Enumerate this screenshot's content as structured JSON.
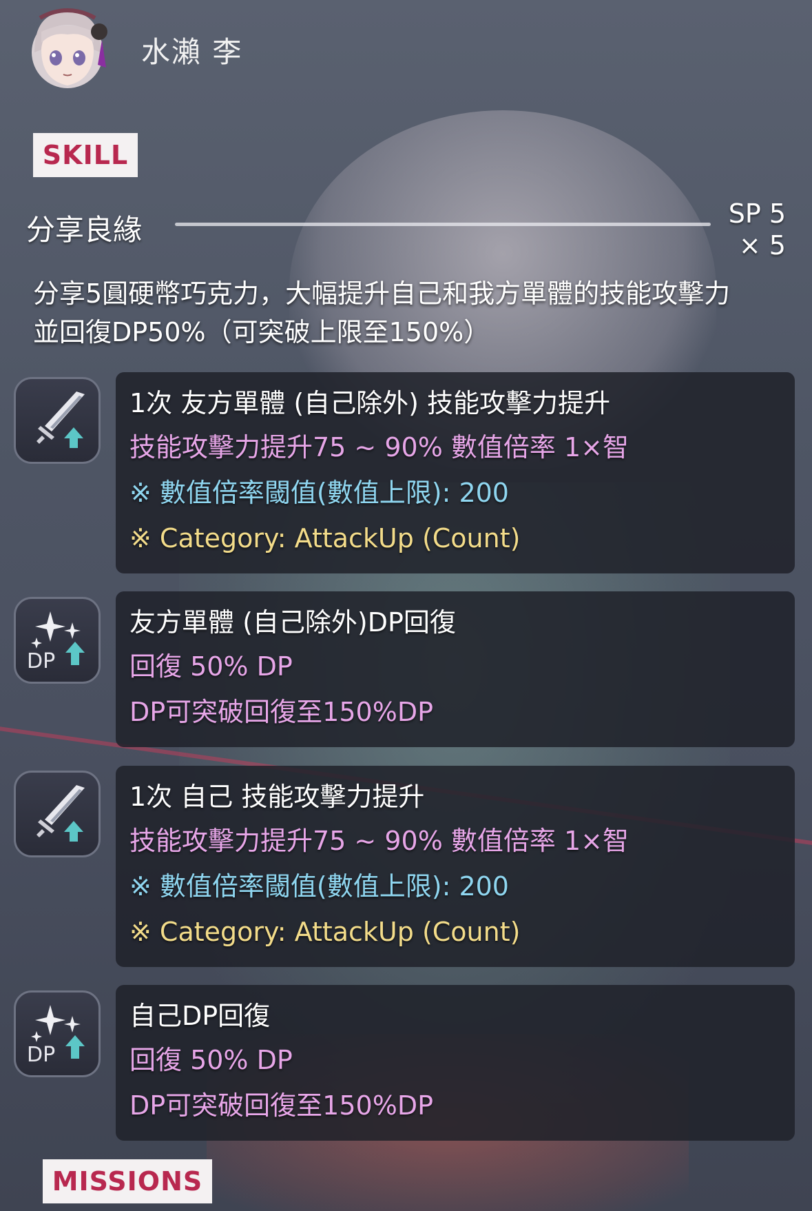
{
  "character": {
    "name": "水瀨 李",
    "avatar_icon": "character-avatar-icon"
  },
  "skill_tag": "SKILL",
  "skill": {
    "name": "分享良緣",
    "sp_line1": "SP 5",
    "sp_line2": "× 5",
    "description_line1": "分享5圓硬幣巧克力，大幅提升自己和我方單體的技能攻擊力",
    "description_line2": "並回復DP50%（可突破上限至150%）"
  },
  "effects": [
    {
      "icon": "attack-up-icon",
      "title": "1次 友方單體 (自己除外) 技能攻擊力提升",
      "lines": [
        "技能攻擊力提升75 ~ 90% 數值倍率 1×智",
        "※ 數值倍率閾值(數值上限): 200",
        "※ Category: AttackUp (Count)"
      ]
    },
    {
      "icon": "dp-recovery-icon",
      "title": "友方單體 (自己除外)DP回復",
      "lines": [
        "回復 50% DP",
        "DP可突破回復至150%DP"
      ]
    },
    {
      "icon": "attack-up-icon",
      "title": "1次 自己 技能攻擊力提升",
      "lines": [
        "技能攻擊力提升75 ~ 90% 數值倍率 1×智",
        "※ 數值倍率閾值(數值上限): 200",
        "※ Category: AttackUp (Count)"
      ]
    },
    {
      "icon": "dp-recovery-icon",
      "title": "自己DP回復",
      "lines": [
        "回復 50% DP",
        "DP可突破回復至150%DP"
      ]
    }
  ],
  "missions_tag": "MISSIONS",
  "colors": {
    "tag_text": "#b8284f",
    "effect_value": "#e7a6e8",
    "effect_note": "#8fd6f0",
    "effect_category": "#f3dc8a"
  }
}
